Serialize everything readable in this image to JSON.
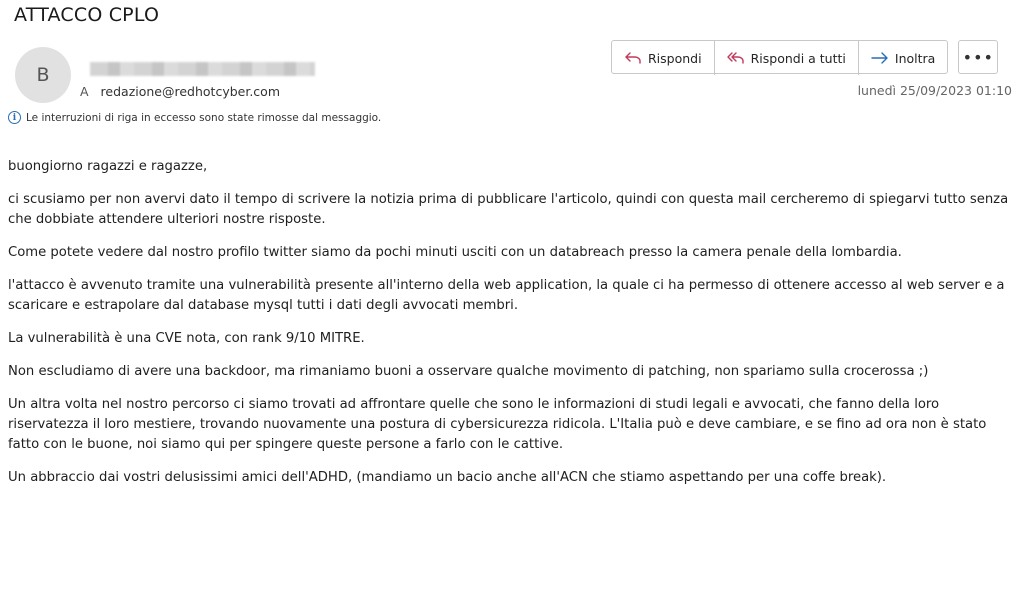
{
  "email": {
    "subject": "ATTACCO CPLO",
    "avatar_initial": "B",
    "to_label": "A",
    "to_address": "redazione@redhotcyber.com",
    "date": "lunedì 25/09/2023 01:10",
    "notice": "Le interruzioni di riga in eccesso sono state rimosse dal messaggio."
  },
  "actions": {
    "reply": "Rispondi",
    "reply_all": "Rispondi a tutti",
    "forward": "Inoltra",
    "more": "•••"
  },
  "icons": {
    "reply": "reply-arrow-icon",
    "reply_all": "reply-all-arrow-icon",
    "forward": "forward-arrow-icon",
    "info": "info-circle-icon"
  },
  "colors": {
    "reply_icon": "#c2385a",
    "forward_icon": "#2a6db5",
    "info_icon": "#2a6db5"
  },
  "body": [
    "buongiorno ragazzi e ragazze,",
    "ci scusiamo per non avervi dato il tempo di scrivere la notizia prima di pubblicare l'articolo, quindi con questa mail cercheremo di spiegarvi tutto senza che dobbiate attendere ulteriori nostre risposte.",
    "Come potete vedere dal nostro profilo twitter siamo da pochi minuti usciti con un databreach presso la camera penale della lombardia.",
    "l'attacco è avvenuto tramite una vulnerabilità presente all'interno della web application, la quale ci ha permesso di ottenere accesso al web server e a scaricare e estrapolare dal database mysql tutti i dati degli avvocati membri.",
    "La vulnerabilità è una CVE nota, con rank 9/10 MITRE.",
    "Non escludiamo di avere una backdoor, ma rimaniamo buoni a osservare qualche movimento di patching, non spariamo sulla crocerossa ;)",
    "Un altra volta nel nostro percorso ci siamo trovati ad affrontare quelle che sono le informazioni di studi legali e avvocati, che fanno della loro riservatezza il loro mestiere, trovando nuovamente una postura di cybersicurezza ridicola. L'Italia può e deve cambiare, e se fino ad ora non è stato fatto con le buone, noi siamo qui per spingere queste persone a farlo con le cattive.",
    "Un abbraccio dai vostri delusissimi amici dell'ADHD, (mandiamo un bacio anche all'ACN che stiamo aspettando per una coffe break)."
  ]
}
